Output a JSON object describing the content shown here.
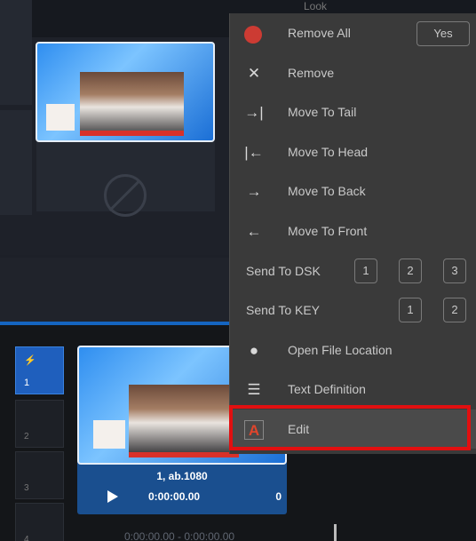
{
  "topbar": {
    "look_label": "Look"
  },
  "preset_grid": {
    "blocked_slot": "ban-icon"
  },
  "menu": {
    "remove_all": "Remove All",
    "yes_button": "Yes",
    "remove": "Remove",
    "move_to_tail": "Move To Tail",
    "move_to_head": "Move To Head",
    "move_to_back": "Move To Back",
    "move_to_front": "Move To Front",
    "send_to_dsk": "Send To DSK",
    "dsk_buttons": [
      "1",
      "2",
      "3"
    ],
    "send_to_key": "Send To KEY",
    "key_buttons": [
      "1",
      "2"
    ],
    "open_file_location": "Open File Location",
    "text_definition": "Text Definition",
    "edit": "Edit"
  },
  "playlist": {
    "slots": [
      "1",
      "2",
      "3",
      "4"
    ],
    "active_slot_icon": "lightning-icon",
    "clip": {
      "name": "1, ab.1080",
      "time": "0:00:00.00",
      "count": "0"
    },
    "range_time": "0:00:00.00  -  0:00:00.00"
  },
  "colors": {
    "accent_blue": "#1f5fbd",
    "highlight_red": "#e10f10",
    "menu_bg": "#3a3a3a"
  }
}
